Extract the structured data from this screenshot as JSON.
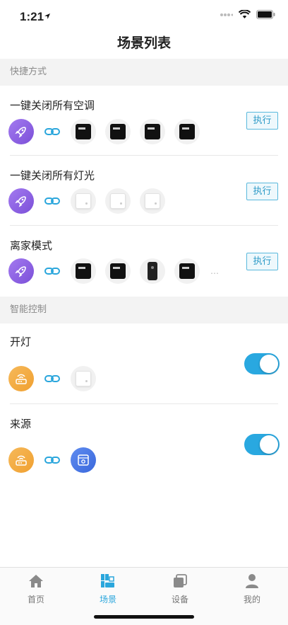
{
  "status_bar": {
    "time": "1:21"
  },
  "header": {
    "title": "场景列表"
  },
  "sections": {
    "shortcuts": "快捷方式",
    "smart_control": "智能控制"
  },
  "shortcut_scenes": [
    {
      "name": "一键关闭所有空调",
      "action": "执行"
    },
    {
      "name": "一键关闭所有灯光",
      "action": "执行"
    },
    {
      "name": "离家模式",
      "action": "执行",
      "more": "…"
    }
  ],
  "smart_scenes": [
    {
      "name": "开灯",
      "enabled": true
    },
    {
      "name": "来源",
      "enabled": true
    }
  ],
  "tabbar": {
    "items": [
      {
        "label": "首页",
        "icon": "home-icon"
      },
      {
        "label": "场景",
        "icon": "scene-icon",
        "active": true
      },
      {
        "label": "设备",
        "icon": "devices-icon"
      },
      {
        "label": "我的",
        "icon": "profile-icon"
      }
    ]
  },
  "colors": {
    "accent": "#29a8e0",
    "rocket": "#8b5ce0",
    "router": "#f3aa40"
  }
}
